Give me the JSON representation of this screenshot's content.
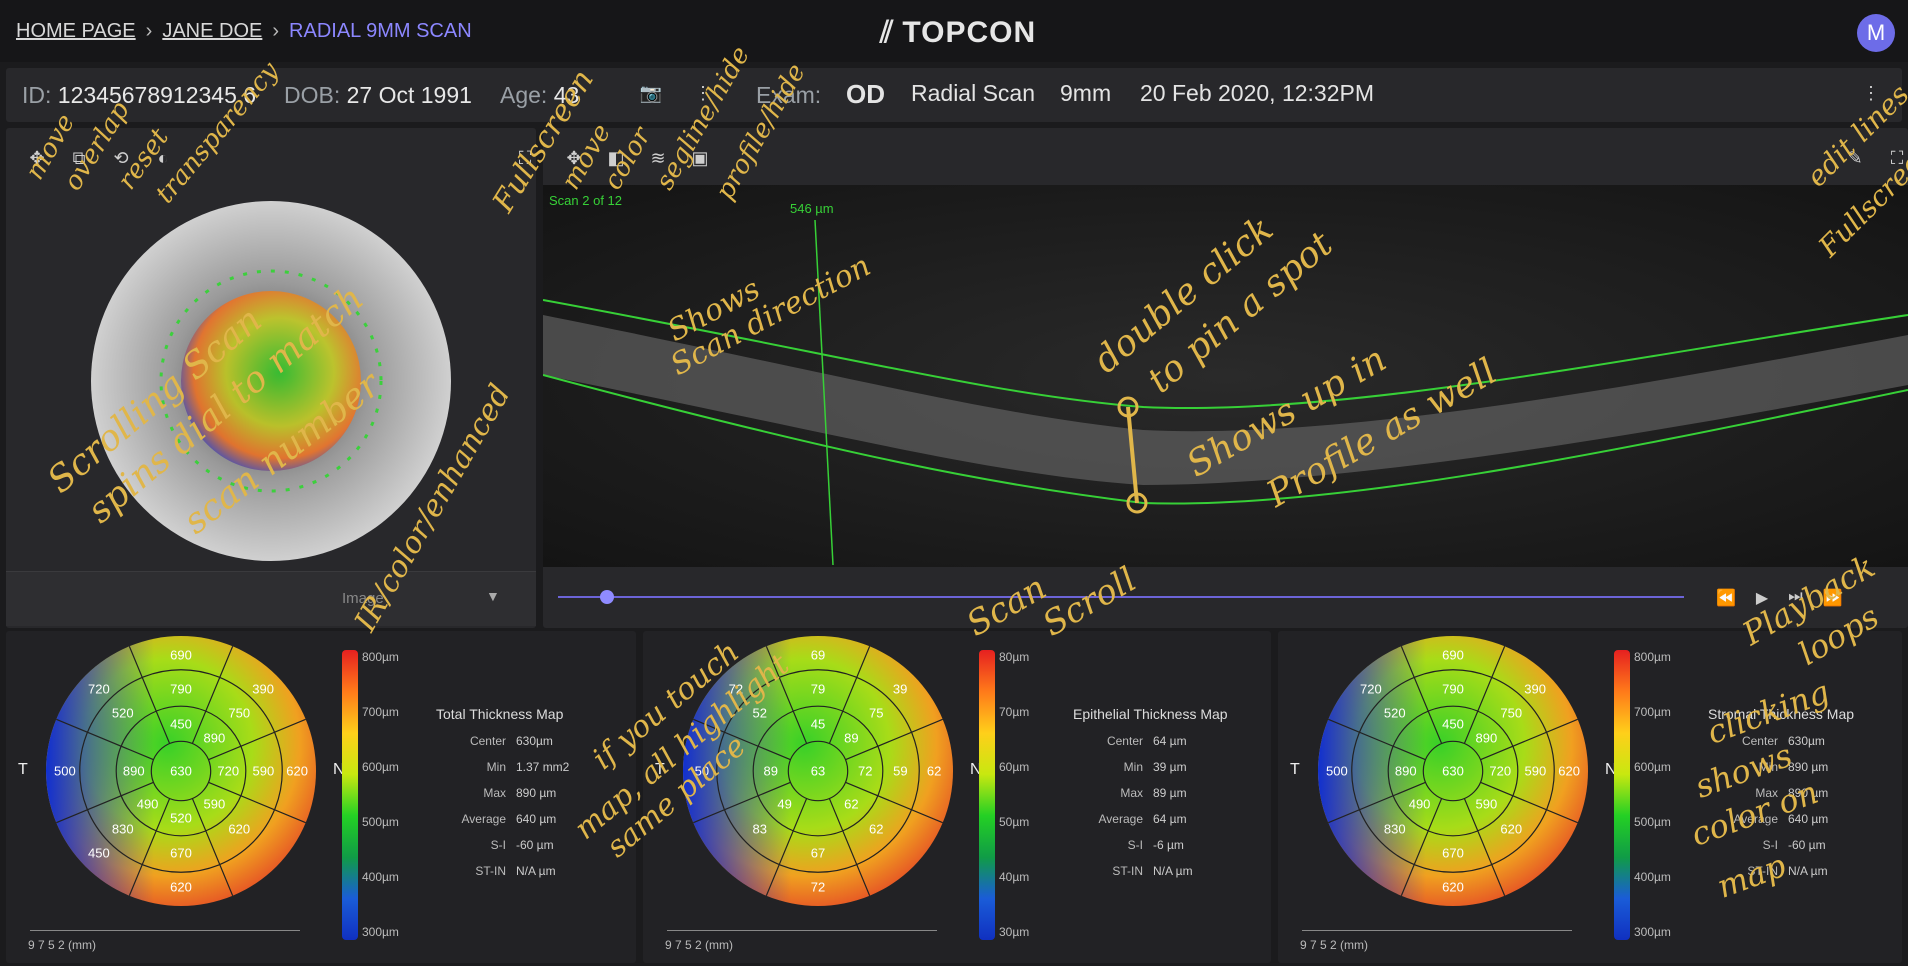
{
  "breadcrumb": {
    "home": "HOME PAGE",
    "patient": "JANE DOE",
    "current": "RADIAL 9MM SCAN"
  },
  "brand": {
    "name": "TOPCON"
  },
  "user": {
    "avatar_letter": "M"
  },
  "patient": {
    "id_label": "ID:",
    "id": "12345678912345 6",
    "dob_label": "DOB:",
    "dob": "27 Oct 1991",
    "age_label": "Age:",
    "age": "43"
  },
  "exam": {
    "label": "Exam:",
    "eye": "OD",
    "type": "Radial Scan",
    "size": "9mm",
    "datetime": "20 Feb 2020, 12:32PM"
  },
  "scan": {
    "counter": "Scan 2 of 12",
    "depth": "546 µm"
  },
  "image_select": {
    "value": "Image"
  },
  "maps": [
    {
      "title": "Total Thickness Map",
      "center": "630µm",
      "min": "1.37 mm2",
      "max": "890 µm",
      "average": "640 µm",
      "si": "-60 µm",
      "stin": "N/A µm",
      "scale": [
        "800µm",
        "700µm",
        "600µm",
        "500µm",
        "400µm",
        "300µm"
      ],
      "rings": [
        "690",
        "750",
        "720",
        "630",
        "670",
        "490",
        "500",
        "520",
        "450",
        "390",
        "590",
        "590",
        "620",
        "830",
        "890",
        "720",
        "790",
        "890",
        "620",
        "620",
        "520",
        "450"
      ]
    },
    {
      "title": "Epithelial Thickness Map",
      "center": "64 µm",
      "min": "39 µm",
      "max": "89 µm",
      "average": "64 µm",
      "si": "-6 µm",
      "stin": "N/A µm",
      "scale": [
        "80µm",
        "70µm",
        "60µm",
        "50µm",
        "40µm",
        "30µm"
      ],
      "rings": [
        "69",
        "75",
        "72",
        "63",
        "67",
        "49",
        "50",
        "52",
        "45",
        "39",
        "59",
        "62",
        "72",
        "83",
        "89",
        "72",
        "79",
        "89",
        "62",
        "62"
      ]
    },
    {
      "title": "Stromal Thickness Map",
      "center": "630µm",
      "min": "890 µm",
      "max": "890 µm",
      "average": "640 µm",
      "si": "-60 µm",
      "stin": "N/A µm",
      "scale": [
        "800µm",
        "700µm",
        "600µm",
        "500µm",
        "400µm",
        "300µm"
      ],
      "rings": [
        "690",
        "750",
        "720",
        "630",
        "670",
        "490",
        "500",
        "520",
        "450",
        "390",
        "590",
        "590",
        "620",
        "830",
        "890",
        "720",
        "790",
        "890",
        "620",
        "620"
      ]
    }
  ],
  "stat_labels": {
    "center": "Center",
    "min": "Min",
    "max": "Max",
    "average": "Average",
    "si": "S-I",
    "stin": "ST-IN"
  },
  "axis": {
    "t": "T",
    "n": "N",
    "mm": "(mm)",
    "ticks": [
      "9",
      "7",
      "5",
      "2"
    ]
  },
  "annotations": {
    "a1": "move",
    "a2": "overlap",
    "a3": "reset",
    "a4": "transparency",
    "a5": "Fullscreen",
    "a6": "move",
    "a7": "color",
    "a8": "segline/hide",
    "a9": "profile/hide",
    "a10": "edit lines",
    "a11": "Fullscreen",
    "a12": "Shows",
    "a13": "Scan direction",
    "a14": "double click",
    "a15": "to pin a spot",
    "a16": "Shows up in",
    "a17": "Profile as well",
    "a18": "Scrolling Scan",
    "a19": "spins dial to match",
    "a20": "scan number",
    "a21": "IR/color/enhanced",
    "a22": "Scan",
    "a23": "Scroll",
    "a24": "Playback",
    "a25": "loops",
    "a26": "if you touch",
    "a27": "map, all highlight",
    "a28": "same place",
    "a29": "clicking",
    "a30": "shows",
    "a31": "color on",
    "a32": "map"
  }
}
